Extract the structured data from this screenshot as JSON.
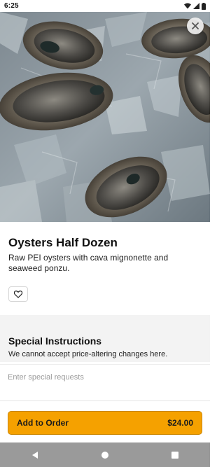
{
  "status_bar": {
    "time": "6:25",
    "icons": [
      "wifi-icon",
      "signal-icon",
      "battery-icon"
    ]
  },
  "hero": {
    "image_subject": "oysters on ice",
    "close_icon": "close-icon"
  },
  "item": {
    "title": "Oysters Half Dozen",
    "description": "Raw PEI oysters with cava mignonette and seaweed ponzu.",
    "favorite_icon": "heart-icon"
  },
  "special_instructions": {
    "title": "Special Instructions",
    "subtitle": "We cannot accept price-altering changes here.",
    "placeholder": "Enter special requests",
    "value": ""
  },
  "order": {
    "button_label": "Add to Order",
    "price": "$24.00",
    "accent_color": "#f5a100"
  },
  "nav_bar": {
    "icons": [
      "back-icon",
      "home-icon",
      "recents-icon"
    ]
  }
}
